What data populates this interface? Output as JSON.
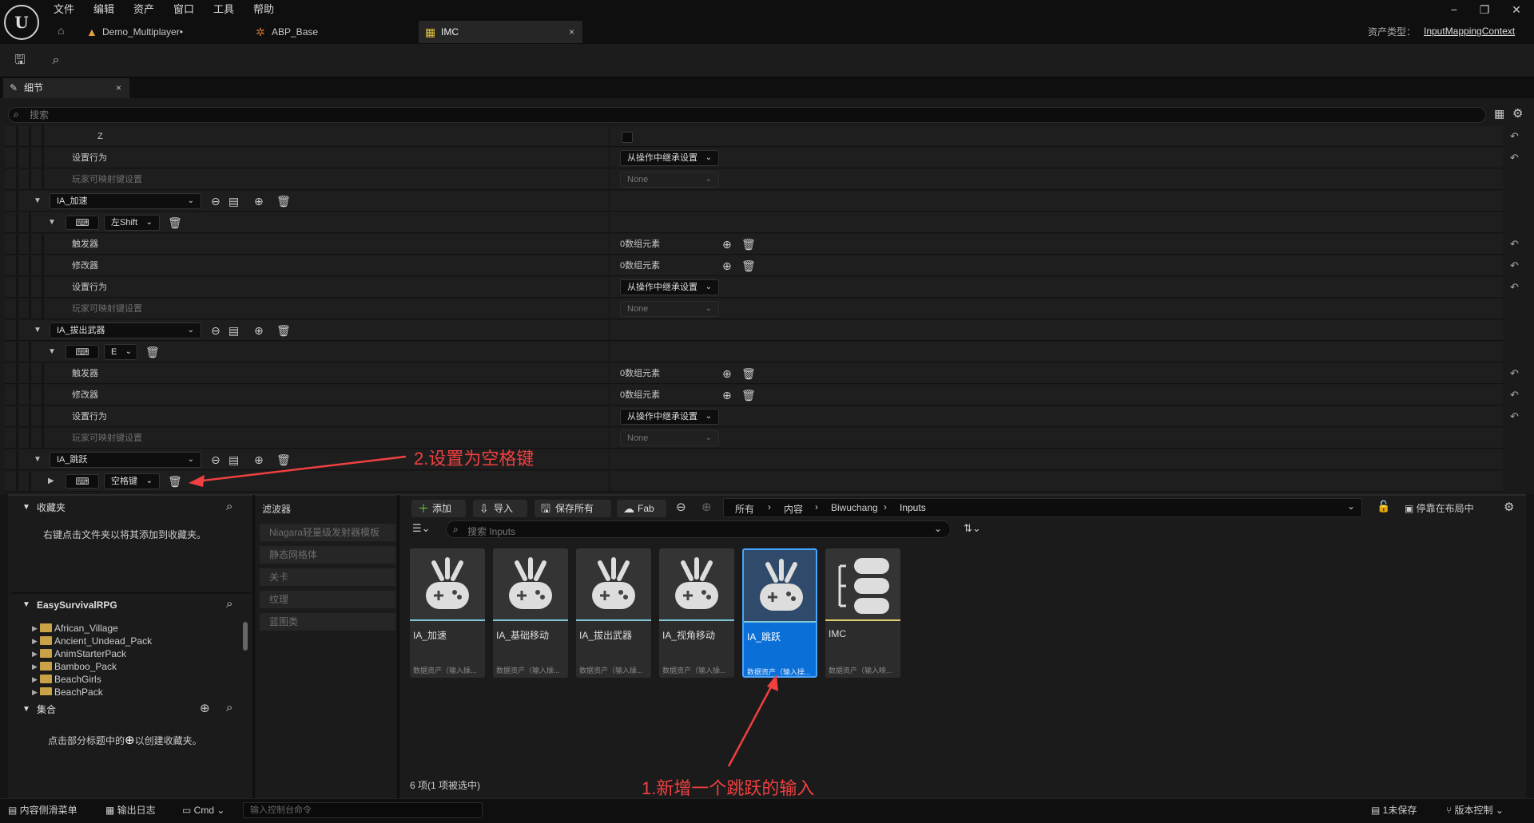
{
  "menu": {
    "items": [
      "文件",
      "编辑",
      "资产",
      "窗口",
      "工具",
      "帮助"
    ]
  },
  "tabs": [
    {
      "label": "Demo_Multiplayer•"
    },
    {
      "label": "ABP_Base"
    },
    {
      "label": "IMC"
    }
  ],
  "asset_type": {
    "label": "资产类型：",
    "value": "InputMappingContext"
  },
  "details": {
    "tab_label": "细节",
    "search_placeholder": "搜索",
    "rows": {
      "z_label": "Z",
      "setting_behavior": "设置行为",
      "inherit": "从操作中继承设置",
      "player_mapping": "玩家可映射键设置",
      "none": "None",
      "ia_accel": "IA_加速",
      "key_lshift": "左Shift",
      "triggers": "触发器",
      "modifiers": "修改器",
      "zero_elems": "0数组元素",
      "ia_draw": "IA_拔出武器",
      "key_e": "E",
      "ia_jump": "IA_跳跃",
      "key_space": "空格键"
    }
  },
  "drawer": {
    "favorites": {
      "title": "收藏夹",
      "hint": "右键点击文件夹以将其添加到收藏夹。"
    },
    "project": {
      "title": "EasySurvivalRPG",
      "folders": [
        "African_Village",
        "Ancient_Undead_Pack",
        "AnimStarterPack",
        "Bamboo_Pack",
        "BeachGirls",
        "BeachPack"
      ]
    },
    "collections": {
      "title": "集合",
      "hint_pre": "点击部分标题中的",
      "hint_post": "以创建收藏夹。"
    },
    "filters": {
      "title": "滤波器",
      "items": [
        "Niagara轻量级发射器模板",
        "静态网格体",
        "关卡",
        "纹理",
        "蓝图类"
      ]
    },
    "toolbar": {
      "add": "添加",
      "import": "导入",
      "save_all": "保存所有",
      "fab": "Fab",
      "dock": "停靠在布局中"
    },
    "breadcrumb": [
      "所有",
      "内容",
      "Biwuchang",
      "Inputs"
    ],
    "search_placeholder": "搜索 Inputs",
    "assets": [
      {
        "name": "IA_加速",
        "type": "数据资产（输入操..."
      },
      {
        "name": "IA_基础移动",
        "type": "数据资产（输入操..."
      },
      {
        "name": "IA_拔出武器",
        "type": "数据资产（输入操..."
      },
      {
        "name": "IA_视角移动",
        "type": "数据资产（输入操..."
      },
      {
        "name": "IA_跳跃",
        "type": "数据资产（输入操..."
      },
      {
        "name": "IMC",
        "type": "数据资产（输入映..."
      }
    ],
    "count": "6 项(1 项被选中)"
  },
  "annotations": {
    "step1": "1.新增一个跳跃的输入",
    "step2": "2.设置为空格键"
  },
  "status": {
    "drawer": "内容侧滑菜单",
    "log": "输出日志",
    "cmd": "Cmd",
    "console_placeholder": "输入控制台命令",
    "unsaved": "1未保存",
    "vcs": "版本控制"
  },
  "colors": {
    "selected": "#0a70d8",
    "annotation": "#f04040",
    "folder": "#c9a247"
  }
}
